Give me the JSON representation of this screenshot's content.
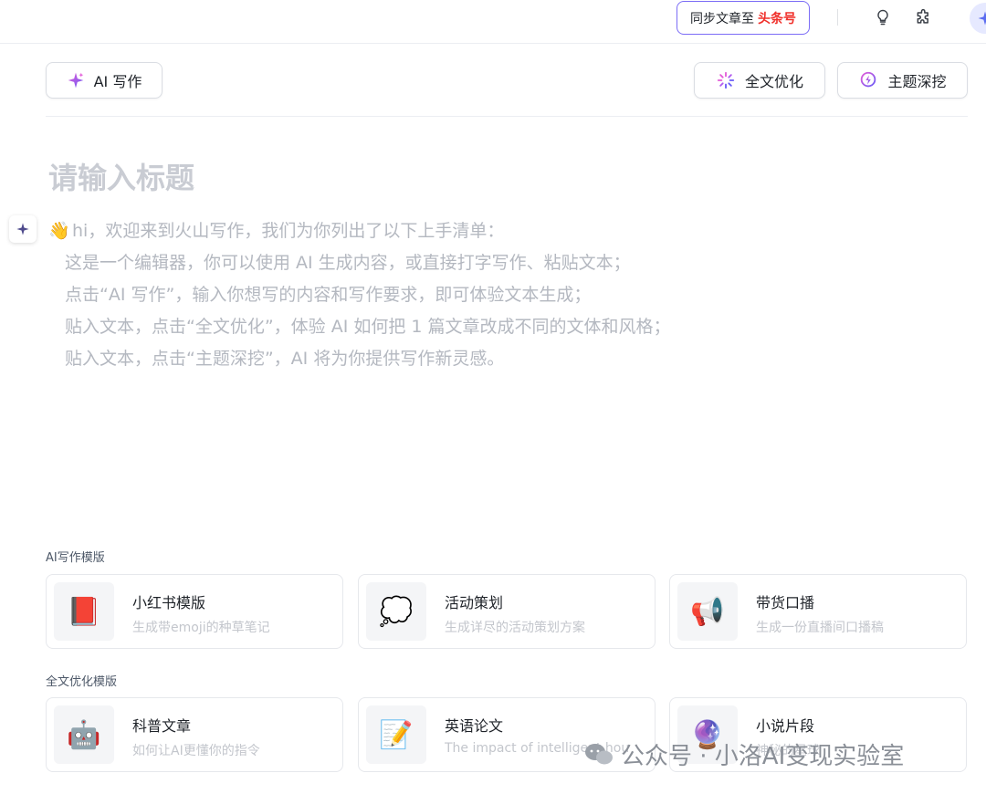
{
  "header": {
    "sync_label": "同步文章至",
    "sync_brand": "头条号",
    "icons": [
      "lightbulb-icon",
      "plugin-icon",
      "avatar"
    ]
  },
  "toolbar": {
    "ai_write": "AI 写作",
    "full_optimize": "全文优化",
    "topic_dig": "主题深挖"
  },
  "editor": {
    "title_placeholder": "请输入标题",
    "intro_emoji": "👋",
    "intro_lines": [
      "hi，欢迎来到火山写作，我们为你列出了以下上手清单：",
      "这是一个编辑器，你可以使用 AI 生成内容，或直接打字写作、粘贴文本；",
      "点击“AI 写作”，输入你想写的内容和写作要求，即可体验文本生成；",
      "贴入文本，点击“全文优化”，体验 AI 如何把 1 篇文章改成不同的文体和风格；",
      "贴入文本，点击“主题深挖”，AI 将为你提供写作新灵感。"
    ]
  },
  "sections": [
    {
      "label": "AI写作模版",
      "cards": [
        {
          "icon": "📕",
          "title": "小红书模版",
          "desc": "生成带emoji的种草笔记"
        },
        {
          "icon": "💭",
          "title": "活动策划",
          "desc": "生成详尽的活动策划方案"
        },
        {
          "icon": "📢",
          "title": "带货口播",
          "desc": "生成一份直播间口播稿"
        }
      ]
    },
    {
      "label": "全文优化模版",
      "cards": [
        {
          "icon": "🤖",
          "title": "科普文章",
          "desc": "如何让AI更懂你的指令"
        },
        {
          "icon": "📝",
          "title": "英语论文",
          "desc": "The impact of intelligent hou"
        },
        {
          "icon": "🔮",
          "title": "小说片段",
          "desc": "神秘的星球"
        }
      ]
    }
  ],
  "watermark": "公众号 · 小洛AI变现实验室",
  "colors": {
    "accent": "#7b6cf6",
    "brand_red": "#f0302b",
    "placeholder": "#c9ccd3"
  }
}
